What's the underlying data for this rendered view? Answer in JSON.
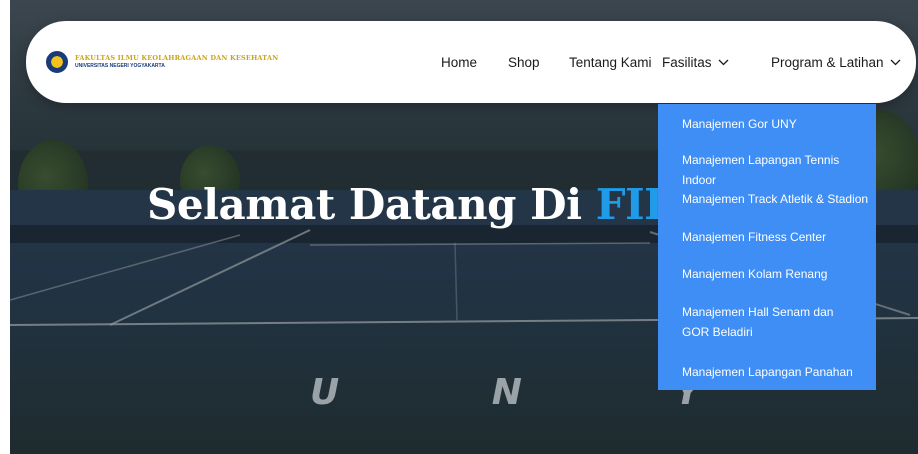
{
  "logo": {
    "line1": "FAKULTAS ILMU KEOLAHRAGAAN DAN KESEHATAN",
    "line2": "UNIVERSITAS NEGERI YOGYAKARTA"
  },
  "nav": {
    "items": [
      {
        "label": "Home"
      },
      {
        "label": "Shop"
      },
      {
        "label": "Tentang Kami"
      },
      {
        "label": "Fasilitas"
      },
      {
        "label": "Program & Latihan"
      }
    ]
  },
  "hero": {
    "title_main": "Selamat Datang Di ",
    "title_accent": "FIKK A",
    "court_letters": "U N Y"
  },
  "dropdown": {
    "items": [
      "Manajemen Gor UNY",
      "Manajemen Lapangan Tennis Indoor",
      "Manajemen Track Atletik & Stadion",
      "Manajemen Fitness Center",
      "Manajemen Kolam Renang",
      "Manajemen Hall Senam dan GOR Beladiri",
      "Manajemen Lapangan Panahan"
    ]
  },
  "colors": {
    "dropdown_bg": "#3f8ef5",
    "accent_title": "#1f9be8",
    "header_bg": "#ffffff"
  }
}
